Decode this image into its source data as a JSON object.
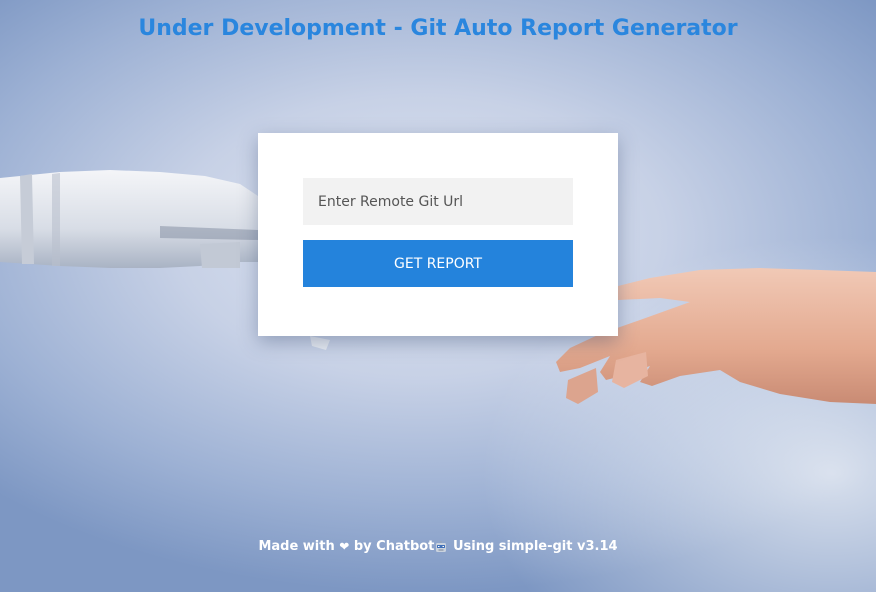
{
  "header": {
    "title": "Under Development - Git Auto Report Generator"
  },
  "form": {
    "url_placeholder": "Enter Remote Git Url",
    "url_value": "",
    "submit_label": "GET REPORT"
  },
  "footer": {
    "made_with": "Made with",
    "by": "by Chatbot",
    "using": "Using simple-git v3.14",
    "heart_icon": "heart-icon",
    "robot_icon": "robot-icon"
  },
  "colors": {
    "title": "#2a86de",
    "button": "#2483dc",
    "input_bg": "#f2f2f2"
  }
}
